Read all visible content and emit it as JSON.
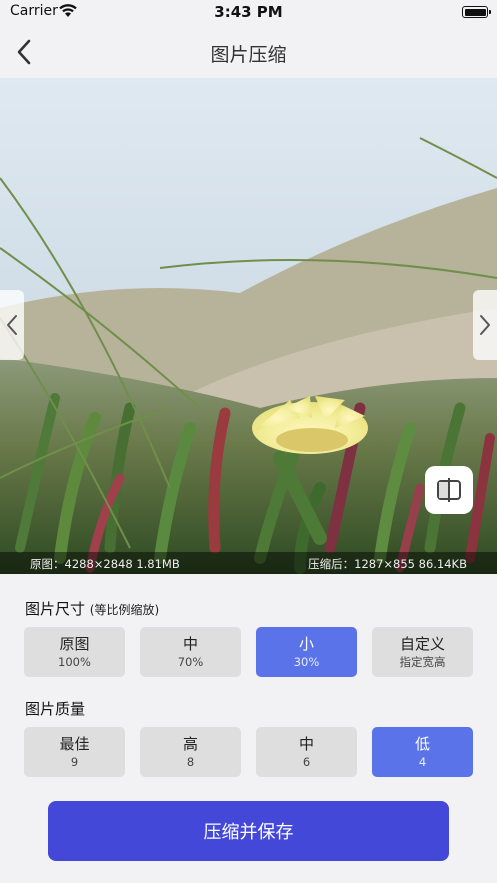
{
  "status": {
    "carrier": "Carrier",
    "time": "3:43 PM"
  },
  "nav": {
    "title": "图片压缩",
    "back_icon": "chevron-left-icon"
  },
  "photo": {
    "original_info": "原图：4288×2848  1.81MB",
    "compressed_info": "压缩后：1287×855  86.14KB",
    "prev_icon": "chevron-left-icon",
    "next_icon": "chevron-right-icon",
    "compare_icon": "split-compare-icon"
  },
  "size_section": {
    "title": "图片尺寸",
    "hint": "(等比例缩放)",
    "options": [
      {
        "label": "原图",
        "sub": "100%",
        "selected": false
      },
      {
        "label": "中",
        "sub": "70%",
        "selected": false
      },
      {
        "label": "小",
        "sub": "30%",
        "selected": true
      },
      {
        "label": "自定义",
        "sub": "指定宽高",
        "selected": false
      }
    ]
  },
  "quality_section": {
    "title": "图片质量",
    "options": [
      {
        "label": "最佳",
        "sub": "9",
        "selected": false
      },
      {
        "label": "高",
        "sub": "8",
        "selected": false
      },
      {
        "label": "中",
        "sub": "6",
        "selected": false
      },
      {
        "label": "低",
        "sub": "4",
        "selected": true
      }
    ]
  },
  "action": {
    "save_label": "压缩并保存"
  },
  "colors": {
    "accent": "#4348d8",
    "selected_option": "#5b73e8",
    "option_bg": "#dedede"
  }
}
